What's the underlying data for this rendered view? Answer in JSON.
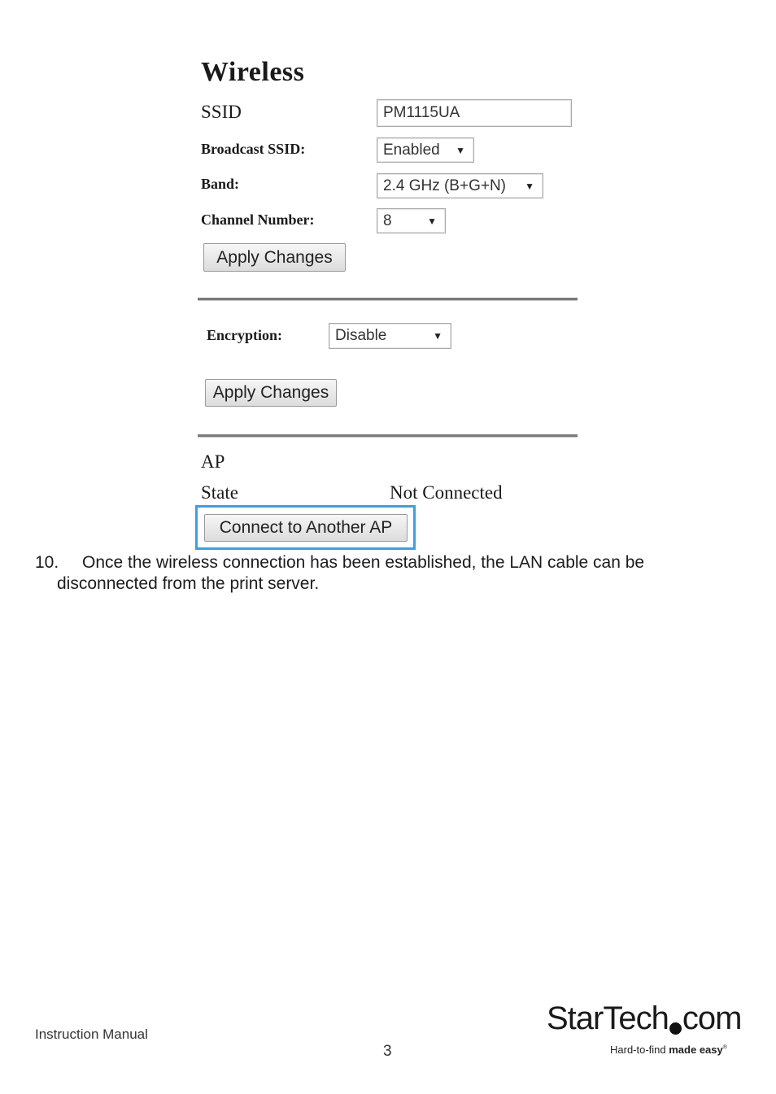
{
  "wireless": {
    "title": "Wireless",
    "ssid_label": "SSID",
    "ssid_value": "PM1115UA",
    "broadcast_label": "Broadcast SSID:",
    "broadcast_value": "Enabled",
    "band_label": "Band:",
    "band_value": "2.4 GHz (B+G+N)",
    "channel_label": "Channel Number:",
    "channel_value": "8",
    "apply_label": "Apply Changes"
  },
  "encryption": {
    "label": "Encryption:",
    "value": "Disable",
    "apply_label": "Apply Changes"
  },
  "ap": {
    "title": "AP",
    "state_label": "State",
    "state_value": "Not Connected",
    "connect_label": "Connect to Another AP",
    "highlight_color": "#3ea0e0"
  },
  "instruction": {
    "number": "10.",
    "text_line1": "Once the wireless connection has been established, the LAN cable can be",
    "text_line2": "disconnected from the print server."
  },
  "footer": {
    "left": "Instruction Manual",
    "page_number": "3",
    "logo_main": "StarTech",
    "logo_suffix": "com",
    "tagline_regular": "Hard-to-find ",
    "tagline_bold": "made easy",
    "tagline_mark": "®"
  },
  "icons": {
    "dropdown": "▼"
  }
}
